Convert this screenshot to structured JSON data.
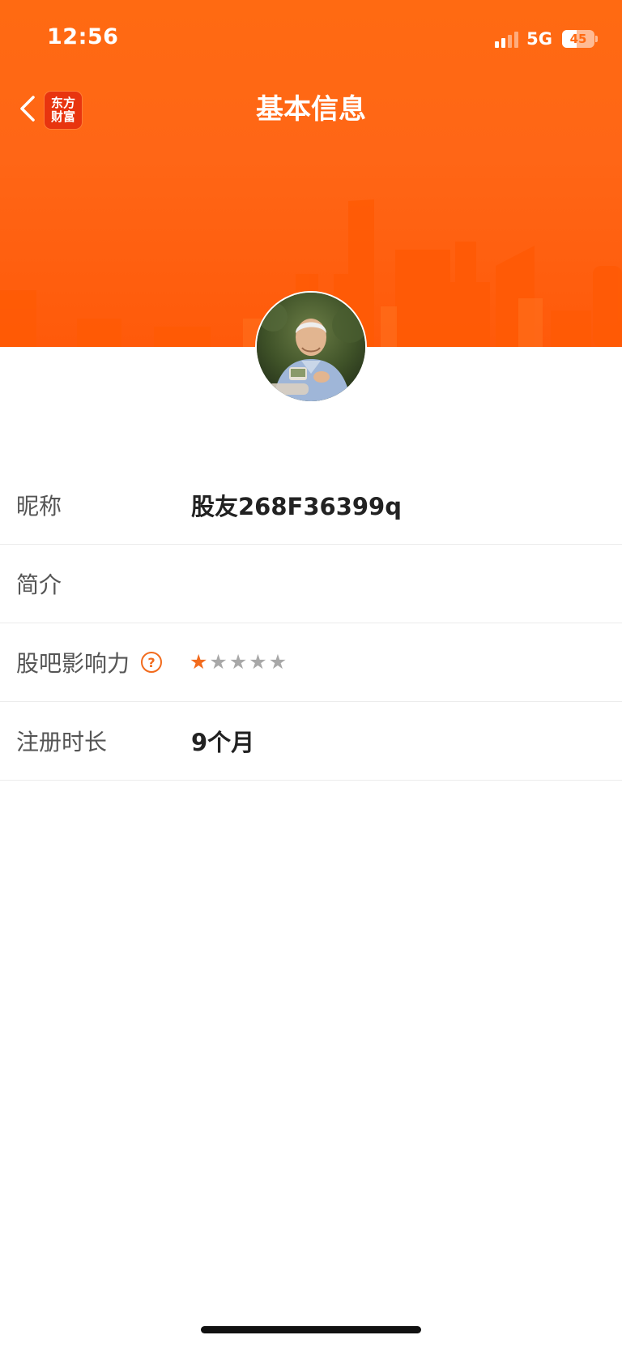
{
  "status_bar": {
    "time": "12:56",
    "network": "5G",
    "battery": "45",
    "battery_level_percent": 45
  },
  "nav": {
    "title": "基本信息",
    "logo_line1": "东方",
    "logo_line2": "财富",
    "back_icon": "chevron-left-icon"
  },
  "colors": {
    "brand_orange": "#ff6a12",
    "star_active": "#f26b1d",
    "star_inactive": "#a8a8a8"
  },
  "profile": {
    "rows": [
      {
        "label": "昵称",
        "value": "股友268F36399q"
      },
      {
        "label": "简介",
        "value": ""
      },
      {
        "label": "股吧影响力",
        "rating": 1,
        "rating_max": 5
      },
      {
        "label": "注册时长",
        "value": "9个月"
      }
    ]
  }
}
